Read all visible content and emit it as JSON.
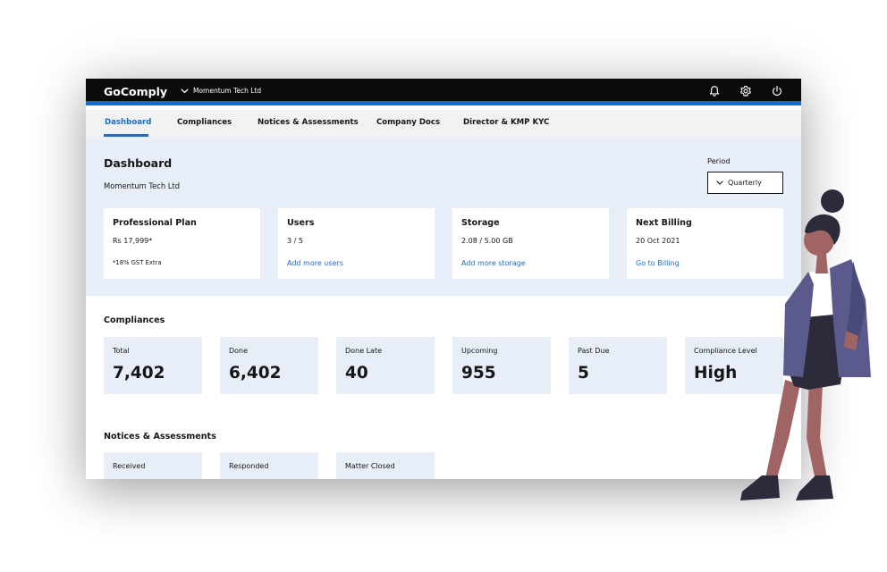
{
  "app": {
    "brand": "GoComply",
    "org_selector": "Momentum Tech Ltd",
    "icons": [
      "bell-icon",
      "gear-icon",
      "power-icon",
      "chevron-down-icon"
    ],
    "colors": {
      "accent": "#1f6cc5",
      "topbar": "#0b0b0b",
      "band": "#e7eef7"
    }
  },
  "tabs": [
    {
      "label": "Dashboard",
      "active": true
    },
    {
      "label": "Compliances",
      "active": false
    },
    {
      "label": "Notices & Assessments",
      "active": false
    },
    {
      "label": "Company Docs",
      "active": false
    },
    {
      "label": "Director & KMP KYC",
      "active": false
    }
  ],
  "header": {
    "title": "Dashboard",
    "subtitle": "Momentum Tech Ltd",
    "period_label": "Period",
    "period_value": "Quarterly"
  },
  "cards": [
    {
      "title": "Professional Plan",
      "value": "Rs 17,999*",
      "note": "*18% GST Extra"
    },
    {
      "title": "Users",
      "value": "3 / 5",
      "link": "Add more users"
    },
    {
      "title": "Storage",
      "value": "2.08 / 5.00 GB",
      "link": "Add more storage"
    },
    {
      "title": "Next Billing",
      "value": "20 Oct 2021",
      "link": "Go to Billing"
    }
  ],
  "compliances": {
    "title": "Compliances",
    "stats": [
      {
        "label": "Total",
        "value": "7,402"
      },
      {
        "label": "Done",
        "value": "6,402"
      },
      {
        "label": "Done Late",
        "value": "40"
      },
      {
        "label": "Upcoming",
        "value": "955"
      },
      {
        "label": "Past Due",
        "value": "5"
      },
      {
        "label": "Compliance Level",
        "value": "High"
      }
    ]
  },
  "notices": {
    "title": "Notices & Assessments",
    "stats": [
      {
        "label": "Received"
      },
      {
        "label": "Responded"
      },
      {
        "label": "Matter Closed"
      }
    ]
  }
}
